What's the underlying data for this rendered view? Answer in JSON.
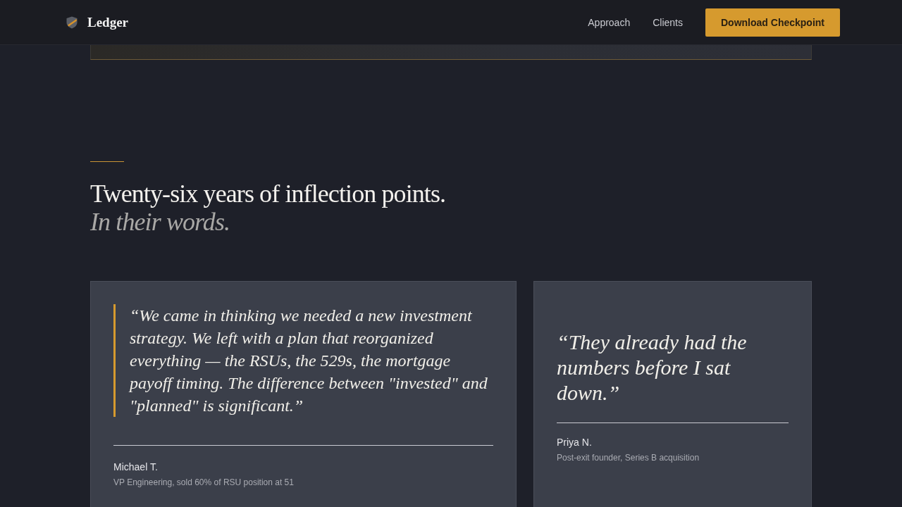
{
  "header": {
    "logo": "Ledger",
    "nav": [
      {
        "label": "Approach"
      },
      {
        "label": "Clients"
      }
    ],
    "cta": "Download Checkpoint"
  },
  "section": {
    "heading": "Twenty-six years of inflection points.",
    "subheading": "In their words.",
    "testimonials": [
      {
        "kind": "featured",
        "quote": "“We came in thinking we needed a new investment strategy. We left with a plan that reorganized everything — the RSUs, the 529s, the mortgage payoff timing. The difference between \"invested\" and \"planned\" is significant.”",
        "name": "Michael T.",
        "role": "VP Engineering, sold 60% of RSU position at 51"
      },
      {
        "kind": "plain",
        "quote": "“They already had the numbers before I sat down.”",
        "name": "Priya N.",
        "role": "Post-exit founder, Series B acquisition"
      }
    ]
  }
}
